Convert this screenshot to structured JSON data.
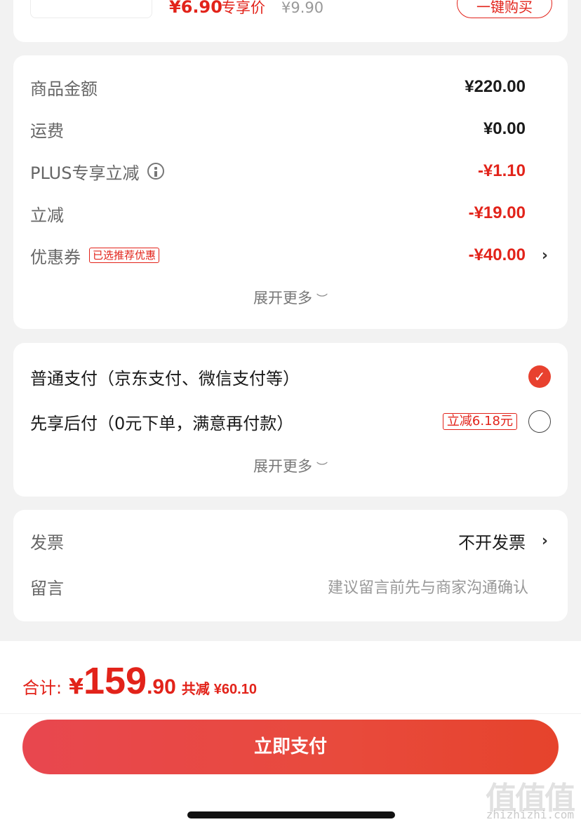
{
  "product_strip": {
    "deal_price": "¥6.90",
    "deal_tag": "专享价",
    "original_price": "¥9.90",
    "buy_button": "一键购买"
  },
  "summary": {
    "rows": [
      {
        "label": "商品金额",
        "value": "¥220.00"
      },
      {
        "label": "运费",
        "value": "¥0.00"
      },
      {
        "label": "PLUS专享立减",
        "value": "-¥1.10"
      },
      {
        "label": "立减",
        "value": "-¥19.00"
      },
      {
        "label": "优惠券",
        "tag": "已选推荐优惠",
        "value": "-¥40.00"
      }
    ],
    "expand_label": "展开更多"
  },
  "payment": {
    "options": [
      {
        "label": "普通支付（京东支付、微信支付等）",
        "selected": true
      },
      {
        "label": "先享后付（0元下单，满意再付款）",
        "promo": "立减6.18元",
        "selected": false
      }
    ],
    "expand_label": "展开更多"
  },
  "invoice": {
    "label": "发票",
    "value": "不开发票"
  },
  "message": {
    "label": "留言",
    "placeholder": "建议留言前先与商家沟通确认"
  },
  "checkout": {
    "total_label": "合计:",
    "currency": "¥",
    "total_int": "159",
    "total_dec": ".90",
    "saved_label": "共减",
    "saved_amount": "¥60.10",
    "pay_button": "立即支付"
  },
  "watermark": {
    "logo": "值值值",
    "url": "zhizhizhi.com"
  },
  "colors": {
    "accent": "#e2231a",
    "background": "#f2f2f2"
  }
}
